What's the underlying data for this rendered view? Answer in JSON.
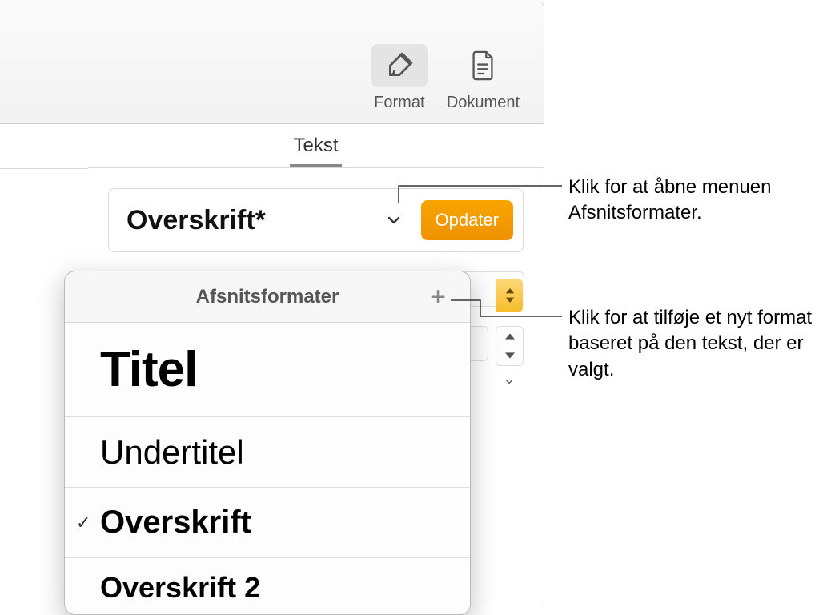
{
  "toolbar": {
    "format_label": "Format",
    "document_label": "Dokument"
  },
  "panel": {
    "tab_label": "Tekst",
    "current_style": "Overskrift*",
    "update_button": "Opdater"
  },
  "popover": {
    "title": "Afsnitsformater",
    "items": [
      {
        "label": "Titel",
        "css": "lbl-title",
        "checked": false
      },
      {
        "label": "Undertitel",
        "css": "lbl-subtitle",
        "checked": false
      },
      {
        "label": "Overskrift",
        "css": "lbl-heading",
        "checked": true
      },
      {
        "label": "Overskrift 2",
        "css": "lbl-heading2",
        "checked": false
      }
    ]
  },
  "callouts": {
    "open_menu": "Klik for at åbne menuen Afsnitsformater.",
    "add_style": "Klik for at tilføje et nyt format baseret på den tekst, der er valgt."
  }
}
